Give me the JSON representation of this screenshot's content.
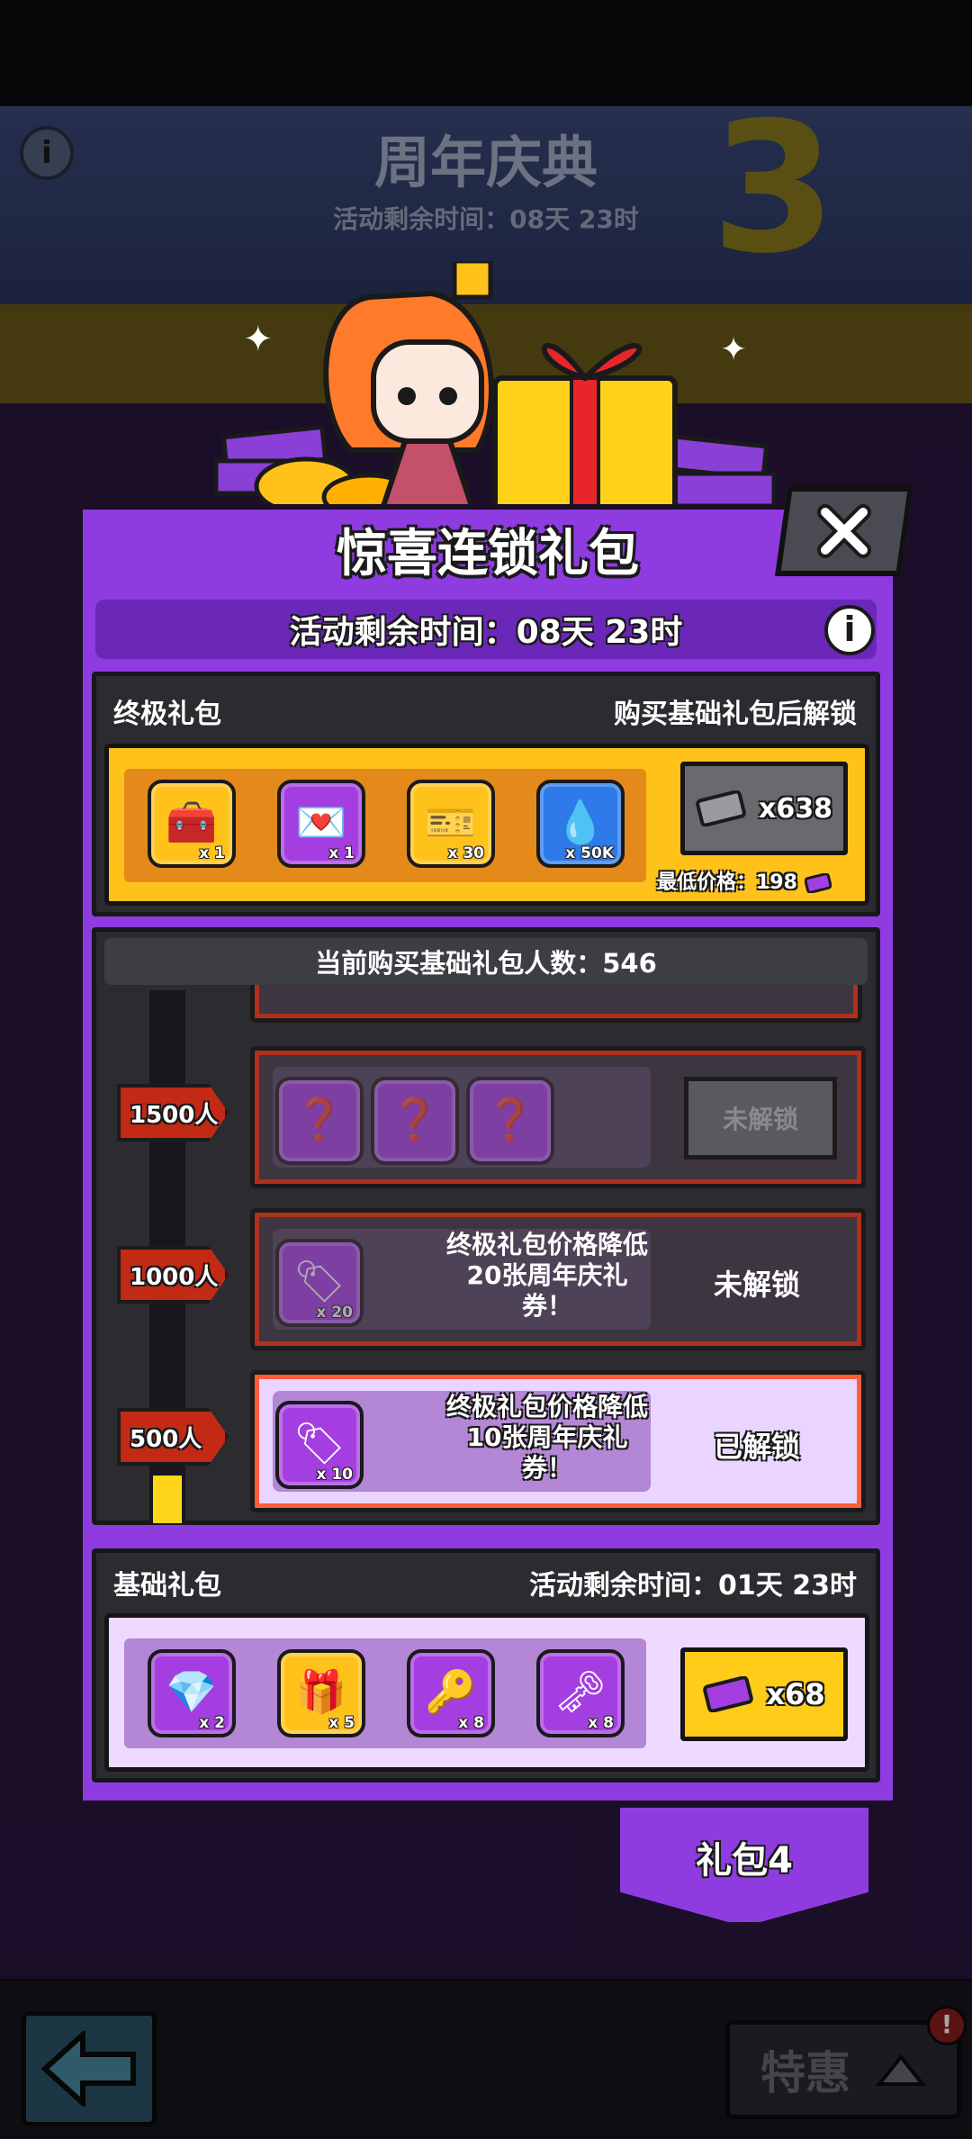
{
  "background": {
    "event_title": "周年庆典",
    "event_timer": "活动剩余时间：08天 23时",
    "anniversary_number": "3",
    "info_glyph": "i"
  },
  "bottom_nav": {
    "back_icon": "arrow-left-icon",
    "special_label": "特惠",
    "special_badge": "!"
  },
  "popup": {
    "title": "惊喜连锁礼包",
    "close_icon": "close-icon",
    "timer": "活动剩余时间：08天 23时",
    "info_glyph": "i"
  },
  "ultimate": {
    "name": "终极礼包",
    "unlock_note": "购买基础礼包后解锁",
    "items": [
      {
        "icon": "chest-icon",
        "qty": "x 1"
      },
      {
        "icon": "heart-letter-icon",
        "qty": "x 1"
      },
      {
        "icon": "ticket-bundle-icon",
        "qty": "x 30"
      },
      {
        "icon": "energy-drop-icon",
        "qty": "x 50K"
      }
    ],
    "price": "x638",
    "price_icon": "anniversary-ticket-icon",
    "min_price": "最低价格：198"
  },
  "milestones": {
    "buyer_count": "当前购买基础礼包人数：546",
    "tiers": [
      {
        "flag": "1500人",
        "status": "未解锁",
        "items": [
          {
            "icon": "mystery-box-icon"
          },
          {
            "icon": "mystery-box-icon"
          },
          {
            "icon": "mystery-box-icon"
          }
        ]
      },
      {
        "flag": "1000人",
        "desc": "终极礼包价格降低20张周年庆礼券！",
        "status": "未解锁",
        "item_qty": "x 20"
      },
      {
        "flag": "500人",
        "desc": "终极礼包价格降低10张周年庆礼券！",
        "status": "已解锁",
        "item_qty": "x 10"
      }
    ],
    "progress_fraction": 0.09
  },
  "basic": {
    "name": "基础礼包",
    "timer": "活动剩余时间：01天 23时",
    "items": [
      {
        "icon": "gem-card-icon",
        "qty": "x 2"
      },
      {
        "icon": "gift-box-icon",
        "qty": "x 5"
      },
      {
        "icon": "gold-key-icon",
        "qty": "x 8"
      },
      {
        "icon": "purple-key-icon",
        "qty": "x 8"
      }
    ],
    "price": "x68"
  },
  "pack_tab": "礼包4",
  "colors": {
    "panel_purple": "#8e3ce0",
    "ultimate_gold": "#ffc21a",
    "tier_red": "#c32a16",
    "unlocked_bg": "#e9d5ff"
  }
}
